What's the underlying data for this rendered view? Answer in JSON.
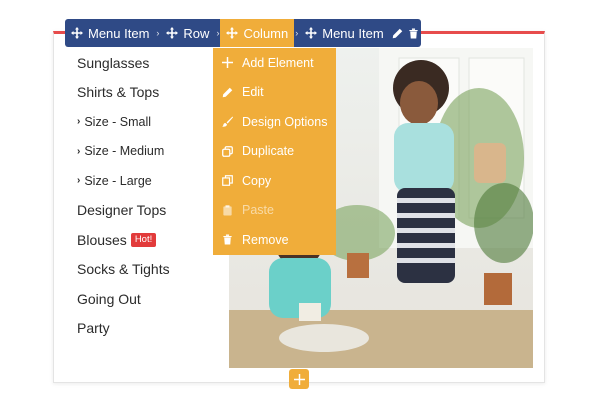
{
  "toolbar": {
    "crumbs": [
      {
        "label": "Menu Item",
        "icon": "move-icon"
      },
      {
        "label": "Row",
        "icon": "move-icon"
      },
      {
        "label": "Column",
        "icon": "move-icon",
        "active": true
      },
      {
        "label": "Menu Item",
        "icon": "move-icon"
      }
    ],
    "actions": [
      {
        "icon": "pencil-icon"
      },
      {
        "icon": "trash-icon"
      }
    ]
  },
  "menu": {
    "items": [
      {
        "label": "Sunglasses"
      },
      {
        "label": "Shirts & Tops"
      },
      {
        "label": "Size - Small",
        "sub": true
      },
      {
        "label": "Size - Medium",
        "sub": true
      },
      {
        "label": "Size - Large",
        "sub": true
      },
      {
        "label": "Designer Tops"
      },
      {
        "label": "Blouses",
        "badge": "Hot!"
      },
      {
        "label": "Socks & Tights"
      },
      {
        "label": "Going Out"
      },
      {
        "label": "Party"
      }
    ]
  },
  "dropdown": {
    "items": [
      {
        "label": "Add Element",
        "icon": "plus-icon"
      },
      {
        "label": "Edit",
        "icon": "pencil-icon"
      },
      {
        "label": "Design Options",
        "icon": "brush-icon"
      },
      {
        "label": "Duplicate",
        "icon": "duplicate-icon"
      },
      {
        "label": "Copy",
        "icon": "copy-icon"
      },
      {
        "label": "Paste",
        "icon": "paste-icon",
        "disabled": true
      },
      {
        "label": "Remove",
        "icon": "trash-icon"
      }
    ]
  },
  "colors": {
    "toolbar_bg": "#2f4a86",
    "accent": "#f0ad3a",
    "top_border": "#e74c4c",
    "hot_badge": "#e23b3b"
  }
}
